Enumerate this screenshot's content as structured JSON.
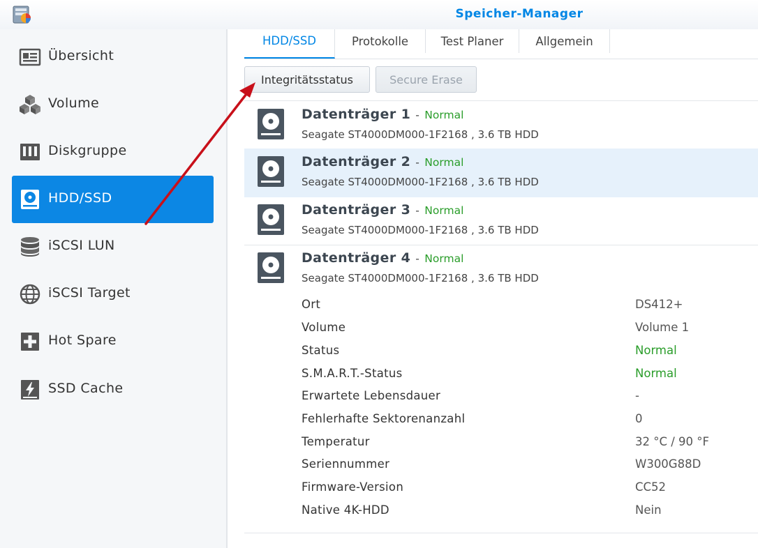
{
  "app": {
    "title": "Speicher-Manager",
    "logo_icon": "synology-storage-icon"
  },
  "sidebar": {
    "items": [
      {
        "label": "Übersicht",
        "icon": "overview-icon",
        "active": false
      },
      {
        "label": "Volume",
        "icon": "volume-cubes-icon",
        "active": false
      },
      {
        "label": "Diskgruppe",
        "icon": "diskgroup-icon",
        "active": false
      },
      {
        "label": "HDD/SSD",
        "icon": "hdd-icon",
        "active": true
      },
      {
        "label": "iSCSI LUN",
        "icon": "database-icon",
        "active": false
      },
      {
        "label": "iSCSI Target",
        "icon": "globe-icon",
        "active": false
      },
      {
        "label": "Hot Spare",
        "icon": "hot-spare-icon",
        "active": false
      },
      {
        "label": "SSD Cache",
        "icon": "ssd-cache-icon",
        "active": false
      }
    ],
    "active_color": "#0c87e4"
  },
  "tabs": [
    {
      "label": "HDD/SSD",
      "active": true
    },
    {
      "label": "Protokolle",
      "active": false
    },
    {
      "label": "Test Planer",
      "active": false
    },
    {
      "label": "Allgemein",
      "active": false
    }
  ],
  "toolbar": {
    "integrity_label": "Integritätsstatus",
    "secure_erase_label": "Secure Erase"
  },
  "disks": [
    {
      "name": "Datenträger 1",
      "separator": "-",
      "status": "Normal",
      "model": "Seagate ST4000DM000-1F2168 , 3.6 TB HDD",
      "selected": false
    },
    {
      "name": "Datenträger 2",
      "separator": "-",
      "status": "Normal",
      "model": "Seagate ST4000DM000-1F2168 , 3.6 TB HDD",
      "selected": true
    },
    {
      "name": "Datenträger 3",
      "separator": "-",
      "status": "Normal",
      "model": "Seagate ST4000DM000-1F2168 , 3.6 TB HDD",
      "selected": false
    },
    {
      "name": "Datenträger 4",
      "separator": "-",
      "status": "Normal",
      "model": "Seagate ST4000DM000-1F2168 , 3.6 TB HDD",
      "selected": false
    }
  ],
  "details": [
    {
      "key": "Ort",
      "value": "DS412+"
    },
    {
      "key": "Volume",
      "value": "Volume 1"
    },
    {
      "key": "Status",
      "value": "Normal",
      "status": true
    },
    {
      "key": "S.M.A.R.T.-Status",
      "value": "Normal",
      "status": true
    },
    {
      "key": "Erwartete Lebensdauer",
      "value": "-"
    },
    {
      "key": "Fehlerhafte Sektorenanzahl",
      "value": "0"
    },
    {
      "key": "Temperatur",
      "value": "32 °C / 90 °F"
    },
    {
      "key": "Seriennummer",
      "value": "W300G88D"
    },
    {
      "key": "Firmware-Version",
      "value": "CC52"
    },
    {
      "key": "Native 4K-HDD",
      "value": "Nein"
    }
  ],
  "colors": {
    "accent": "#0086e5",
    "status_ok": "#2a9d2a",
    "annotation_arrow": "#d0101a"
  }
}
